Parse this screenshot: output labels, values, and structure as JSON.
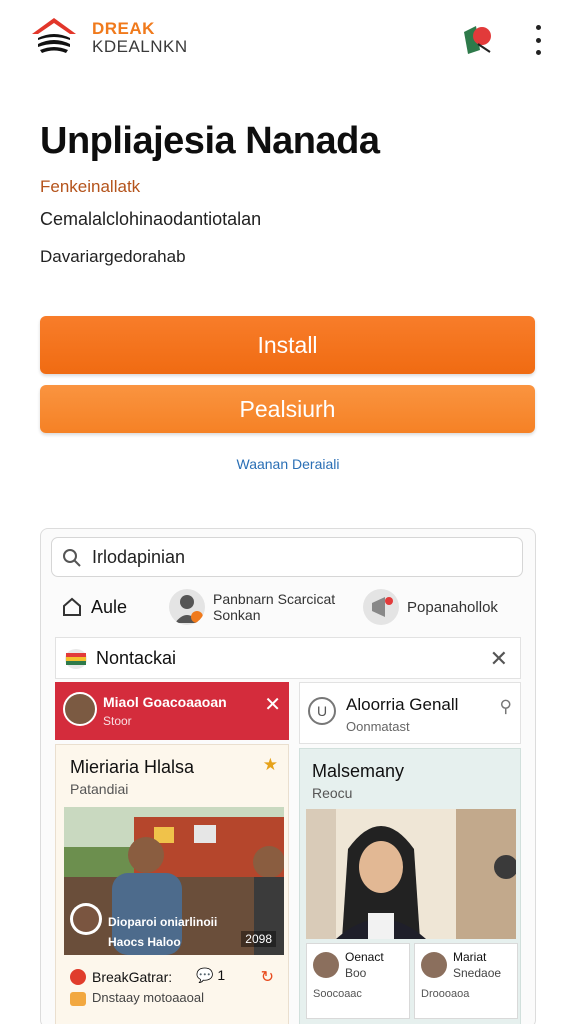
{
  "header": {
    "brand_line1": "DREAK",
    "brand_line2": "KDEALNKN"
  },
  "app": {
    "title": "Unpliajesia Nanada",
    "developer": "Fenkeinallatk",
    "line2": "Cemalalclohinaodantiotalan",
    "line3": "Davariargedorahab"
  },
  "buttons": {
    "install": "Install",
    "secondary": "Pealsiurh",
    "link": "Waanan Deraiali"
  },
  "preview": {
    "search_text": "Irlodapinian",
    "tabs": {
      "tab1": "Aule",
      "tab2_line1": "Panbnarn Scarcicat",
      "tab2_line2": "Sonkan",
      "tab3": "Popanahollok"
    },
    "notice": "Nontackai",
    "left": {
      "red_title": "Miaol Goacoaaoan",
      "red_sub": "Stoor",
      "card_title": "Mieriaria Hlalsa",
      "card_sub": "Patandiai",
      "photo_caption": "Dioparoi oniarlinoii",
      "photo_caption2": "Haocs Haloo",
      "photo_badge": "2098",
      "footer1": "BreakGatrar:",
      "footer_count": "1",
      "footer2": "Dnstaay motoaaoal"
    },
    "right": {
      "top_title": "Aloorria Genall",
      "top_sub": "Oonmatast",
      "card_title": "Malsemany",
      "card_sub": "Reocu",
      "mini1_a": "Oenact",
      "mini1_b": "Boo",
      "mini1_c": "Soocoaac",
      "mini2_a": "Mariat",
      "mini2_b": "Snedaoe",
      "mini2_c": "Droooaoa"
    }
  },
  "colors": {
    "accent": "#f07a1c",
    "install": "#f56f16",
    "secondary": "#f68628",
    "red_bar": "#d42c3c",
    "link": "#2a6fb5"
  }
}
